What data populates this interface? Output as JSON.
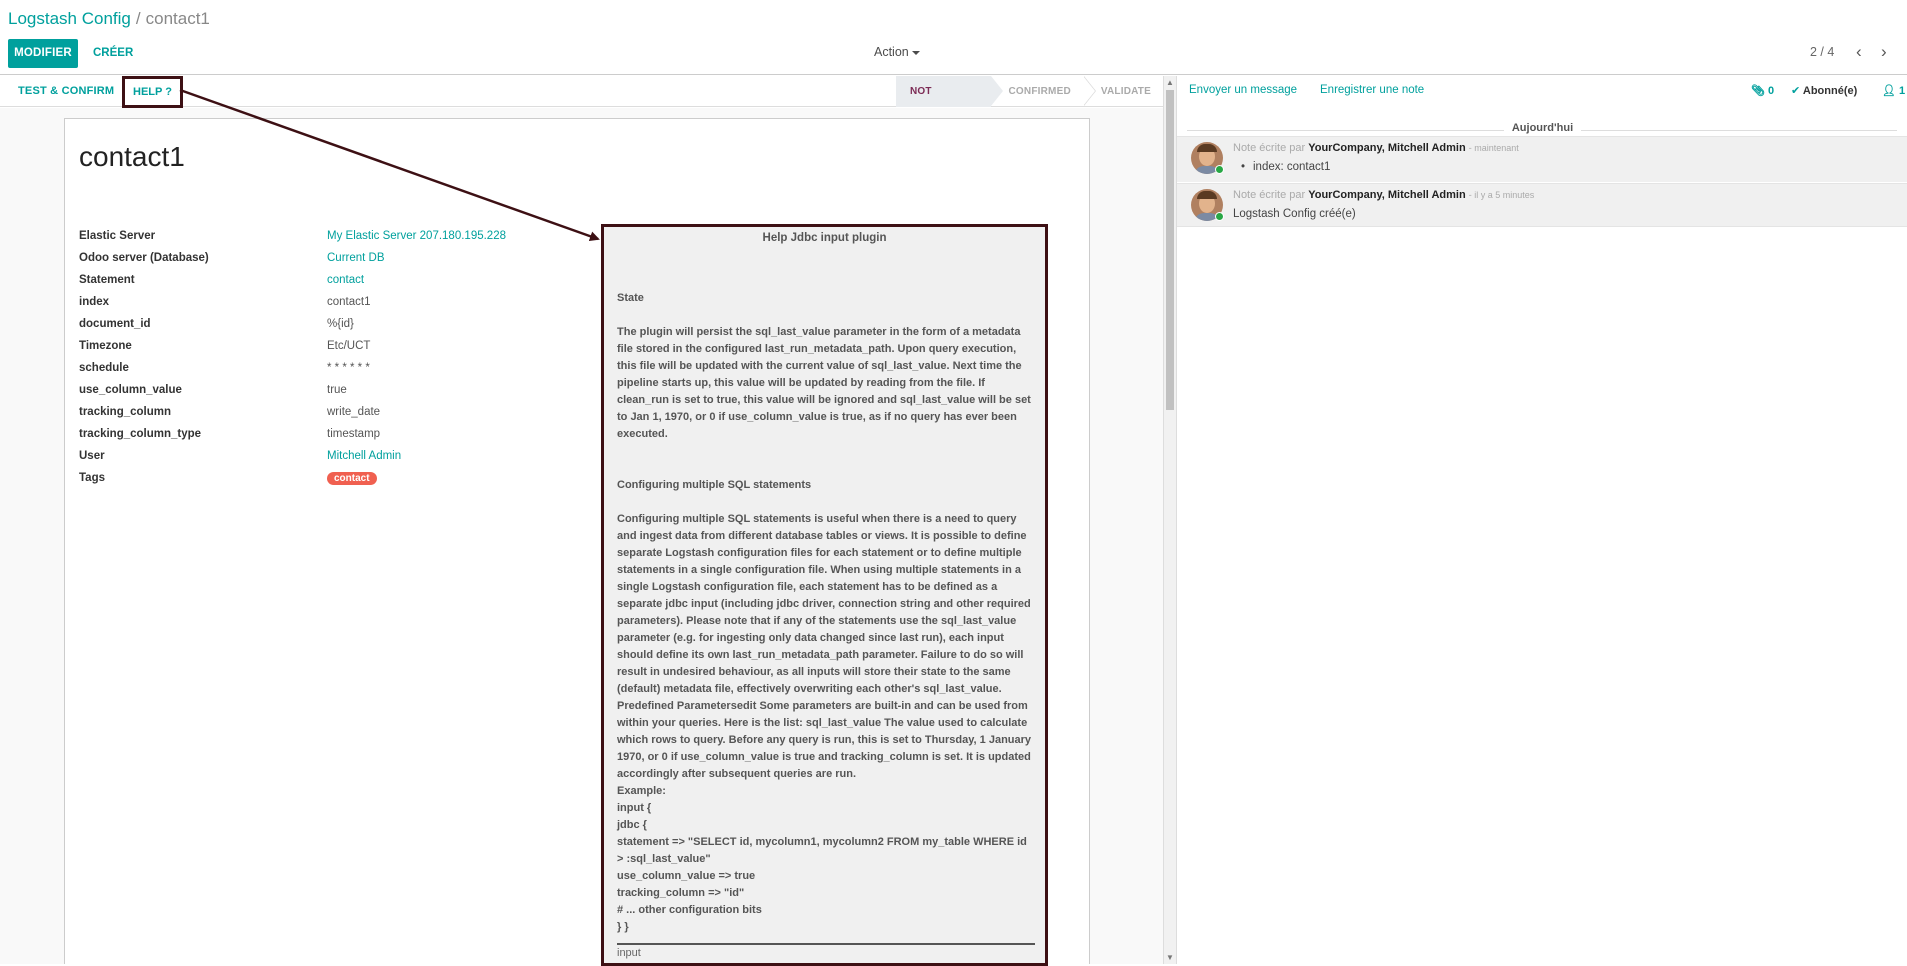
{
  "breadcrumb": {
    "parent": "Logstash Config",
    "separator": "/",
    "current": "contact1"
  },
  "toolbar": {
    "edit_label": "MODIFIER",
    "create_label": "CRÉER",
    "action_label": "Action"
  },
  "pager": {
    "value": "2 / 4",
    "prev_icon": "chevron-left-icon",
    "next_icon": "chevron-right-icon"
  },
  "header": {
    "test_button": "TEST & CONFIRM",
    "help_button": "HELP ?",
    "stages": [
      {
        "label": "NOT CONFIRMED",
        "active": true
      },
      {
        "label": "CONFIRMED",
        "active": false
      },
      {
        "label": "VALIDATE",
        "active": false
      }
    ]
  },
  "record": {
    "title": "contact1",
    "fields": [
      {
        "label": "Elastic Server",
        "value": "My Elastic Server 207.180.195.228",
        "link": true
      },
      {
        "label": "Odoo server (Database)",
        "value": "Current DB",
        "link": true
      },
      {
        "label": "Statement",
        "value": "contact",
        "link": true
      },
      {
        "label": "index",
        "value": "contact1",
        "link": false
      },
      {
        "label": "document_id",
        "value": "%{id}",
        "link": false
      },
      {
        "label": "Timezone",
        "value": "Etc/UCT",
        "link": false
      },
      {
        "label": "schedule",
        "value": "* * * * * *",
        "link": false
      },
      {
        "label": "use_column_value",
        "value": "true",
        "link": false
      },
      {
        "label": "tracking_column",
        "value": "write_date",
        "link": false
      },
      {
        "label": "tracking_column_type",
        "value": "timestamp",
        "link": false
      },
      {
        "label": "User",
        "value": "Mitchell Admin",
        "link": true
      }
    ],
    "tags_label": "Tags",
    "tags": [
      "contact"
    ]
  },
  "help": {
    "title": "Help Jdbc input plugin",
    "state_heading": "State",
    "state_text": "The plugin will persist the sql_last_value parameter in the form of a metadata file stored in the configured last_run_metadata_path. Upon query execution, this file will be updated with the current value of sql_last_value. Next time the pipeline starts up, this value will be updated by reading from the file. If clean_run is set to true, this value will be ignored and sql_last_value will be set to Jan 1, 1970, or 0 if use_column_value is true, as if no query has ever been executed.",
    "multi_heading": "Configuring multiple SQL statements",
    "multi_text": "Configuring multiple SQL statements is useful when there is a need to query and ingest data from different database tables or views. It is possible to define separate Logstash configuration files for each statement or to define multiple statements in a single configuration file. When using multiple statements in a single Logstash configuration file, each statement has to be defined as a separate jdbc input (including jdbc driver, connection string and other required parameters). Please note that if any of the statements use the sql_last_value parameter (e.g. for ingesting only data changed since last run), each input should define its own last_run_metadata_path parameter. Failure to do so will result in undesired behaviour, as all inputs will store their state to the same (default) metadata file, effectively overwriting each other's sql_last_value. Predefined Parametersedit Some parameters are built-in and can be used from within your queries. Here is the list: sql_last_value The value used to calculate which rows to query. Before any query is run, this is set to Thursday, 1 January 1970, or 0 if use_column_value is true and tracking_column is set. It is updated accordingly after subsequent queries are run.",
    "example_label": "Example:",
    "code_lines": [
      "input {",
      "jdbc {",
      "statement => \"SELECT id, mycolumn1, mycolumn2 FROM my_table WHERE id > :sql_last_value\"",
      "use_column_value => true",
      "tracking_column => \"id\"",
      "# ... other configuration bits",
      "} }"
    ],
    "footer": "input"
  },
  "chatter": {
    "send_message": "Envoyer un message",
    "log_note": "Enregistrer une note",
    "attachments": "0",
    "attachment_icon": "paperclip-icon",
    "follow_label": "Abonné(e)",
    "followers": "1",
    "followers_icon": "user-icon",
    "date_separator": "Aujourd'hui",
    "messages": [
      {
        "kind": "Note écrite par",
        "author": "YourCompany, Mitchell Admin",
        "time": "- maintenant",
        "body": "index: contact1",
        "bullet": true
      },
      {
        "kind": "Note écrite par",
        "author": "YourCompany, Mitchell Admin",
        "time": "- il y a 5 minutes",
        "body": "Logstash Config créé(e)",
        "bullet": false
      }
    ]
  },
  "colors": {
    "accent": "#00a09d",
    "annotation": "#3d1014",
    "active_stage": "#7c2b55",
    "tag": "#f06050"
  }
}
